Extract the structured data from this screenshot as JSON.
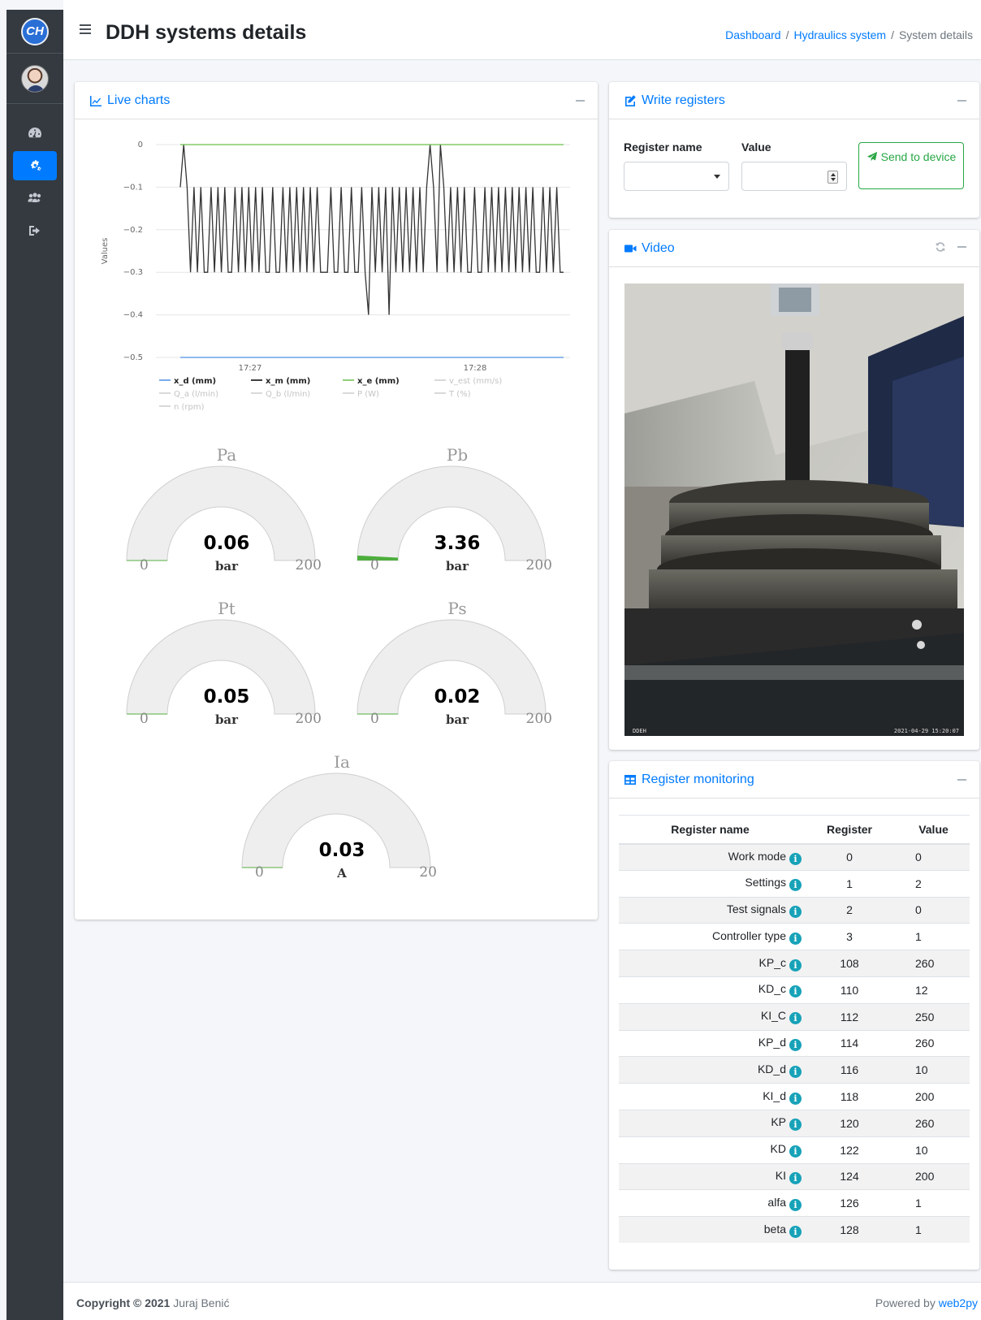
{
  "sidebar": {
    "logo": "CH",
    "nav": [
      "dashboard-icon",
      "cogs-icon",
      "users-cog-icon",
      "sign-out-icon"
    ],
    "active_index": 1
  },
  "header": {
    "title": "DDH systems details",
    "breadcrumb": [
      "Dashboard",
      "Hydraulics system",
      "System details"
    ]
  },
  "live_charts": {
    "title": "Live charts",
    "legend": [
      {
        "label": "x_d (mm)",
        "color": "#4a90e2",
        "active": true
      },
      {
        "label": "x_m (mm)",
        "color": "#000000",
        "active": true
      },
      {
        "label": "x_e (mm)",
        "color": "#6cc04a",
        "active": true
      },
      {
        "label": "v_est (mm/s)",
        "color": "#cccccc",
        "active": false
      },
      {
        "label": "Q_a (l/min)",
        "color": "#cccccc",
        "active": false
      },
      {
        "label": "Q_b (l/min)",
        "color": "#cccccc",
        "active": false
      },
      {
        "label": "P (W)",
        "color": "#cccccc",
        "active": false
      },
      {
        "label": "T (%)",
        "color": "#cccccc",
        "active": false
      },
      {
        "label": "n (rpm)",
        "color": "#cccccc",
        "active": false
      }
    ]
  },
  "chart_data": {
    "type": "line",
    "title": "",
    "xlabel": "",
    "ylabel": "Values",
    "ylim": [
      -0.5,
      0
    ],
    "yticks": [
      0,
      -0.1,
      -0.2,
      -0.3,
      -0.4,
      -0.5
    ],
    "xticks": [
      "17:27",
      "17:28"
    ],
    "series": [
      {
        "name": "x_d (mm)",
        "values": [
          -0.5,
          -0.5
        ]
      },
      {
        "name": "x_m (mm)",
        "values": [
          -0.1,
          0,
          -0.1,
          -0.3,
          -0.1,
          -0.3,
          -0.1,
          -0.3,
          -0.3,
          -0.1,
          -0.3,
          -0.1,
          -0.3,
          -0.1,
          -0.3,
          -0.3,
          -0.1,
          -0.3,
          -0.1,
          -0.3,
          -0.1,
          -0.3,
          -0.1,
          -0.3,
          -0.1,
          -0.3,
          -0.3,
          -0.1,
          -0.3,
          -0.3,
          -0.1,
          -0.3,
          -0.1,
          -0.3,
          -0.1,
          -0.3,
          -0.1,
          -0.3,
          -0.1,
          -0.3,
          -0.1,
          -0.3,
          -0.3,
          -0.3,
          -0.1,
          -0.3,
          -0.3,
          -0.1,
          -0.3,
          -0.3,
          -0.1,
          -0.3,
          -0.3,
          -0.1,
          -0.3,
          -0.4,
          -0.1,
          -0.3,
          -0.1,
          -0.3,
          -0.1,
          -0.4,
          -0.1,
          -0.3,
          -0.1,
          -0.3,
          -0.1,
          -0.3,
          -0.1,
          -0.3,
          -0.1,
          -0.3,
          -0.1,
          0,
          -0.1,
          -0.3,
          0,
          -0.1,
          -0.3,
          -0.1,
          -0.3,
          -0.1,
          -0.3,
          -0.1,
          -0.3,
          -0.3,
          -0.1,
          -0.3,
          -0.3,
          -0.1,
          -0.3,
          -0.1,
          -0.3,
          -0.1,
          -0.3,
          -0.1,
          -0.3,
          -0.1,
          -0.3,
          -0.1,
          -0.3,
          -0.1,
          -0.3,
          -0.1,
          -0.3,
          -0.3,
          -0.1,
          -0.3,
          -0.1,
          -0.3,
          -0.1,
          -0.3,
          -0.3
        ]
      },
      {
        "name": "x_e (mm)",
        "values": [
          0,
          0
        ]
      }
    ]
  },
  "gauges": [
    {
      "title": "Pa",
      "value": "0.06",
      "unit": "bar",
      "min": "0",
      "max": "200",
      "level": 0.0003
    },
    {
      "title": "Pb",
      "value": "3.36",
      "unit": "bar",
      "min": "0",
      "max": "200",
      "level": 0.0168
    },
    {
      "title": "Pt",
      "value": "0.05",
      "unit": "bar",
      "min": "0",
      "max": "200",
      "level": 0.00025
    },
    {
      "title": "Ps",
      "value": "0.02",
      "unit": "bar",
      "min": "0",
      "max": "200",
      "level": 0.0001
    },
    {
      "title": "Ia",
      "value": "0.03",
      "unit": "A",
      "min": "0",
      "max": "20",
      "level": 0.0015
    }
  ],
  "write_registers": {
    "title": "Write registers",
    "register_label": "Register name",
    "value_label": "Value",
    "button_label": "Send to device"
  },
  "video": {
    "title": "Video",
    "overlay_left": "DDEH",
    "overlay_right": "2021-04-29 15:20:07"
  },
  "register_monitoring": {
    "title": "Register monitoring",
    "columns": [
      "Register name",
      "Register",
      "Value"
    ],
    "rows": [
      [
        "Work mode",
        "0",
        "0"
      ],
      [
        "Settings",
        "1",
        "2"
      ],
      [
        "Test signals",
        "2",
        "0"
      ],
      [
        "Controller type",
        "3",
        "1"
      ],
      [
        "KP_c",
        "108",
        "260"
      ],
      [
        "KD_c",
        "110",
        "12"
      ],
      [
        "KI_C",
        "112",
        "250"
      ],
      [
        "KP_d",
        "114",
        "260"
      ],
      [
        "KD_d",
        "116",
        "10"
      ],
      [
        "KI_d",
        "118",
        "200"
      ],
      [
        "KP",
        "120",
        "260"
      ],
      [
        "KD",
        "122",
        "10"
      ],
      [
        "KI",
        "124",
        "200"
      ],
      [
        "alfa",
        "126",
        "1"
      ],
      [
        "beta",
        "128",
        "1"
      ]
    ]
  },
  "footer": {
    "copyright_bold": "Copyright © 2021",
    "author": "Juraj Benić",
    "powered_prefix": "Powered by",
    "powered_link": "web2py"
  }
}
